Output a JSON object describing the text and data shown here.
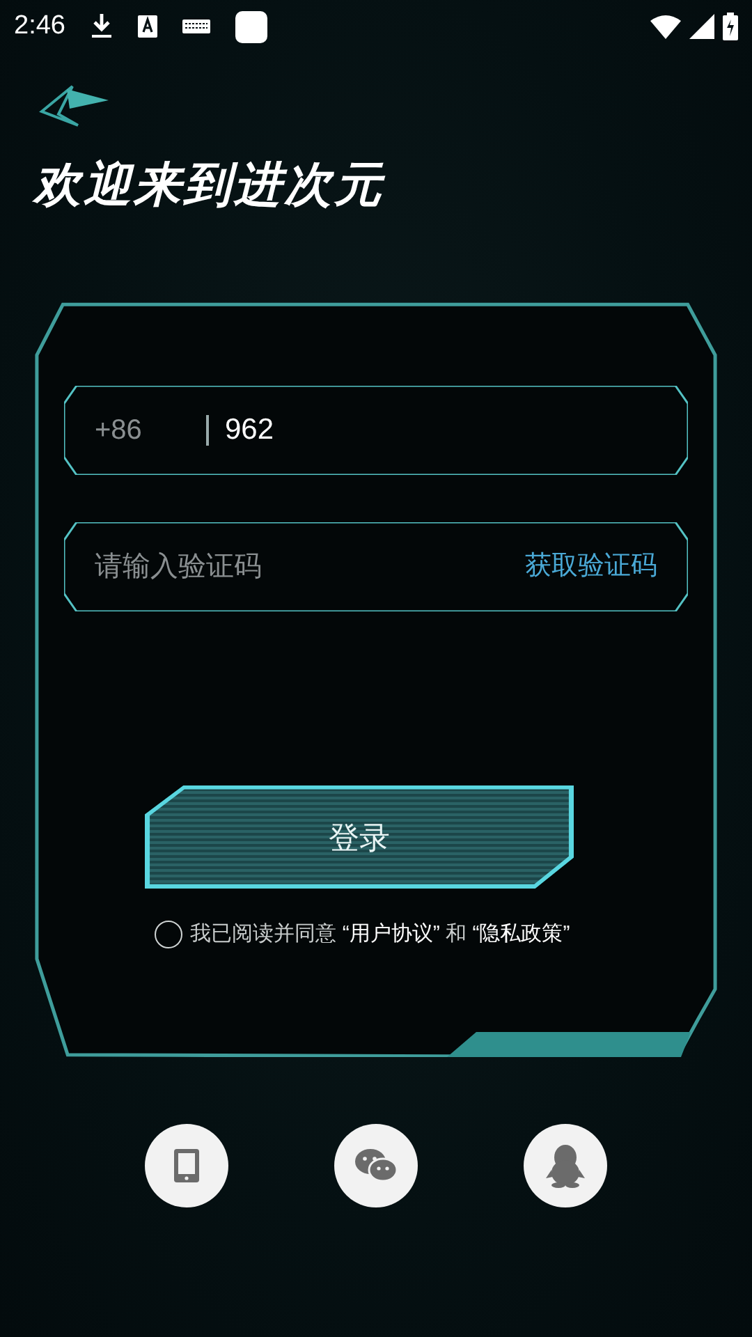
{
  "status_bar": {
    "time": "2:46"
  },
  "title": "欢迎来到进次元",
  "phone_field": {
    "country_code": "+86",
    "value": "962"
  },
  "code_field": {
    "placeholder": "请输入验证码",
    "action": "获取验证码"
  },
  "login_button": "登录",
  "agreement": {
    "checked": false,
    "text": "我已阅读并同意",
    "links": [
      "“用户协议”",
      "“隐私政策”"
    ],
    "joiner": "和"
  },
  "social_logins": [
    {
      "kind": "phone"
    },
    {
      "kind": "wechat"
    },
    {
      "kind": "qq"
    }
  ]
}
